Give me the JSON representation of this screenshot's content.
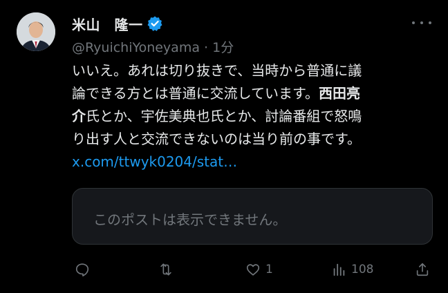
{
  "author": {
    "display_name": "米山　隆一",
    "handle": "@RyuichiYoneyama",
    "separator": " · ",
    "time": "1分",
    "verified_icon": "verified-badge-icon",
    "verified_color": "#1d9bf0"
  },
  "tweet": {
    "lines": [
      "いいえ。あれは切り抜きで、当時から普通に議",
      "論できる方とは普通に交流しています。",
      "介",
      "氏とか、宇佐美典也氏とか、討論番組で怒鳴",
      "り出す人と交流できないのは当り前の事です。"
    ],
    "bold_name_part1": "西田亮",
    "link": "x.com/ttwyk0204/stat…",
    "link_color": "#1d9bf0"
  },
  "quote": {
    "unavailable_text": "このポストは表示できません。"
  },
  "actions": {
    "reply": {
      "icon": "reply-icon",
      "count": ""
    },
    "retweet": {
      "icon": "retweet-icon",
      "count": ""
    },
    "like": {
      "icon": "heart-icon",
      "count": "1"
    },
    "views": {
      "icon": "views-chart-icon",
      "count": "108"
    },
    "share": {
      "icon": "share-icon",
      "count": ""
    }
  },
  "colors": {
    "background": "#000000",
    "text": "#e7e9ea",
    "muted": "#71767b",
    "border": "#2f3336"
  }
}
